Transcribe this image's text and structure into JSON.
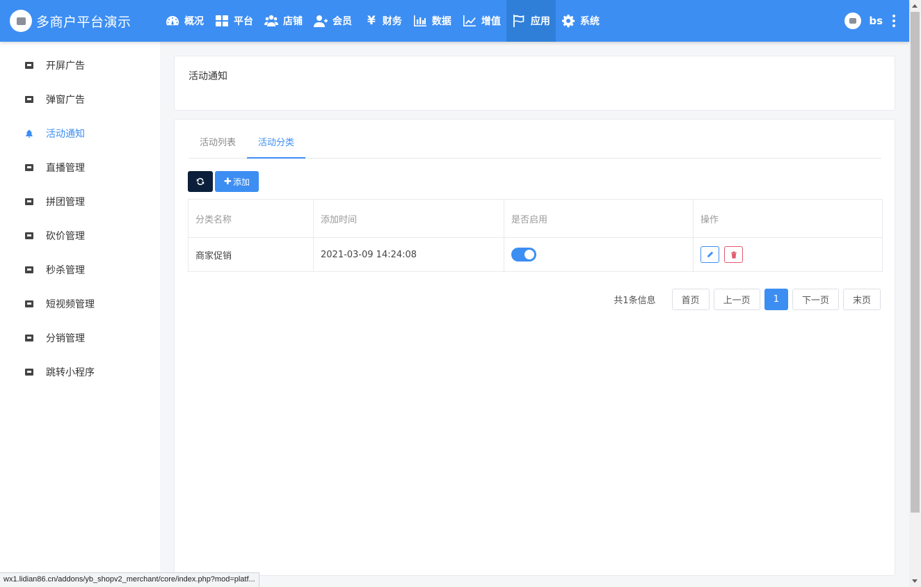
{
  "app": {
    "title": "多商户平台演示"
  },
  "topnav": {
    "items": [
      {
        "label": "概况",
        "icon": "dashboard-icon"
      },
      {
        "label": "平台",
        "icon": "grid-icon"
      },
      {
        "label": "店铺",
        "icon": "users-icon"
      },
      {
        "label": "会员",
        "icon": "user-plus-icon"
      },
      {
        "label": "财务",
        "icon": "yen-icon",
        "glyph": "¥"
      },
      {
        "label": "数据",
        "icon": "bar-chart-icon"
      },
      {
        "label": "增值",
        "icon": "line-chart-icon"
      },
      {
        "label": "应用",
        "icon": "flag-icon",
        "active": true
      },
      {
        "label": "系统",
        "icon": "gear-icon"
      }
    ]
  },
  "user": {
    "name": "bs"
  },
  "sidebar": {
    "items": [
      {
        "label": "开屏广告"
      },
      {
        "label": "弹窗广告"
      },
      {
        "label": "活动通知",
        "active": true
      },
      {
        "label": "直播管理"
      },
      {
        "label": "拼团管理"
      },
      {
        "label": "砍价管理"
      },
      {
        "label": "秒杀管理"
      },
      {
        "label": "短视频管理"
      },
      {
        "label": "分销管理"
      },
      {
        "label": "跳转小程序"
      }
    ]
  },
  "page": {
    "title": "活动通知"
  },
  "tabs": [
    {
      "label": "活动列表"
    },
    {
      "label": "活动分类",
      "active": true
    }
  ],
  "toolbar": {
    "add_label": "添加"
  },
  "table": {
    "headers": [
      "分类名称",
      "添加时间",
      "是否启用",
      "操作"
    ],
    "rows": [
      {
        "name": "商家促销",
        "time": "2021-03-09 14:24:08",
        "enabled": true
      }
    ]
  },
  "pagination": {
    "info": "共1条信息",
    "first": "首页",
    "prev": "上一页",
    "current": "1",
    "next": "下一页",
    "last": "末页"
  },
  "status_bar": {
    "url": "wx1.lidian86.cn/addons/yb_shopv2_merchant/core/index.php?mod=platf..."
  },
  "colors": {
    "primary": "#3c8ef3",
    "dark_button": "#0b1f3a",
    "danger": "#e05a6d"
  }
}
